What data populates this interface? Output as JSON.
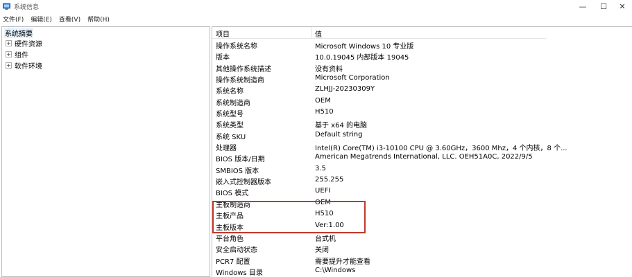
{
  "window": {
    "title": "系统信息",
    "minimize": "—",
    "maximize": "☐",
    "close": "✕"
  },
  "menu": [
    "文件(F)",
    "编辑(E)",
    "查看(V)",
    "帮助(H)"
  ],
  "tree": {
    "root": "系统摘要",
    "children": [
      "硬件资源",
      "组件",
      "软件环境"
    ],
    "expander": "+"
  },
  "table": {
    "headers": {
      "item": "项目",
      "value": "值"
    },
    "rows": [
      [
        "操作系统名称",
        "Microsoft Windows 10 专业版"
      ],
      [
        "版本",
        "10.0.19045 内部版本 19045"
      ],
      [
        "其他操作系统描述",
        "没有资料"
      ],
      [
        "操作系统制造商",
        "Microsoft Corporation"
      ],
      [
        "系统名称",
        "ZLHJJ-20230309Y"
      ],
      [
        "系统制造商",
        "OEM"
      ],
      [
        "系统型号",
        "H510"
      ],
      [
        "系统类型",
        "基于 x64 的电脑"
      ],
      [
        "系统 SKU",
        "Default string"
      ],
      [
        "处理器",
        "Intel(R) Core(TM) i3-10100 CPU @ 3.60GHz，3600 Mhz，4 个内核，8 个..."
      ],
      [
        "BIOS 版本/日期",
        "American Megatrends International, LLC. OEH51A0C, 2022/9/5"
      ],
      [
        "SMBIOS 版本",
        "3.5"
      ],
      [
        "嵌入式控制器版本",
        "255.255"
      ],
      [
        "BIOS 模式",
        "UEFI"
      ],
      [
        "主板制造商",
        "OEM"
      ],
      [
        "主板产品",
        "H510"
      ],
      [
        "主板版本",
        "Ver:1.00"
      ],
      [
        "平台角色",
        "台式机"
      ],
      [
        "安全启动状态",
        "关闭"
      ],
      [
        "PCR7 配置",
        "需要提升才能查看"
      ],
      [
        "Windows 目录",
        "C:\\Windows"
      ]
    ]
  },
  "colors": {
    "highlight_box": "#c0392b",
    "selected_tree": "#e5f3ff"
  }
}
